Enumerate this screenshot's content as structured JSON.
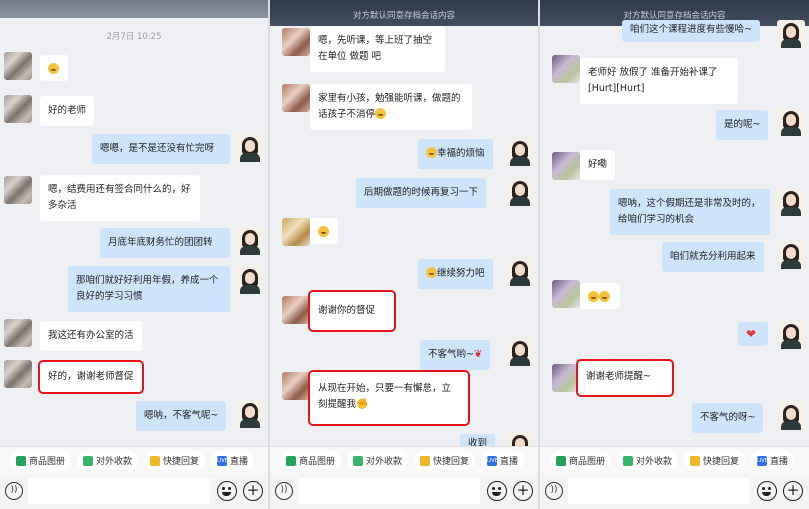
{
  "header": {
    "title": "对方默认同意存档会话内容"
  },
  "panel0": {
    "timestamp": "2月7日 10:25",
    "messages": [
      {
        "text": "好的老师"
      },
      {
        "text": "嗯嗯，是不是还没有忙完呀"
      },
      {
        "text": "嗯，结费用还有签合同什么的，好多杂活"
      },
      {
        "text": "月底年底财务忙的团团转"
      },
      {
        "text": "那咱们就好好利用年假，养成一个良好的学习习惯"
      },
      {
        "text": "我这还有办公室的活"
      },
      {
        "text": "好的，谢谢老师督促"
      },
      {
        "text": "嗯呐，不客气呢~"
      }
    ]
  },
  "panel1": {
    "messages": [
      {
        "text": "嗯，先听课，等上班了抽空在单位 做题 吧"
      },
      {
        "text": "家里有小孩，勉强能听课，做题的话孩子不消停"
      },
      {
        "text": "幸福的烦恼"
      },
      {
        "text": "后期做题的时候再复习一下"
      },
      {
        "text": "继续努力吧"
      },
      {
        "text": "谢谢你的督促"
      },
      {
        "text": "不客气哟~"
      },
      {
        "text": "从现在开始，只要一有懈怠，立刻提醒我"
      },
      {
        "text": "收到"
      }
    ]
  },
  "panel2": {
    "messages": [
      {
        "text": "咱们这个课程进度有些慢哈~"
      },
      {
        "text": "老师好 放假了 准备开始补课了[Hurt][Hurt]"
      },
      {
        "text": "是的呢~"
      },
      {
        "text": "好嘞"
      },
      {
        "text": "嗯呐，这个假期还是非常及时的，给咱们学习的机会"
      },
      {
        "text": "咱们就充分利用起来"
      },
      {
        "text": "谢谢老师提醒~"
      },
      {
        "text": "不客气的呀~"
      }
    ]
  },
  "toolbar": {
    "items": [
      {
        "label": "商品图册",
        "icon": "album-icon"
      },
      {
        "label": "对外收款",
        "icon": "payment-icon"
      },
      {
        "label": "快捷回复",
        "icon": "quick-reply-icon"
      },
      {
        "label": "直播",
        "icon": "live-icon",
        "badge": "LIVE"
      }
    ]
  },
  "colors": {
    "incoming": "#ffffff",
    "outgoing": "#cde4fb",
    "highlight": "#e8141c",
    "topbar": "#2f3a4c"
  }
}
